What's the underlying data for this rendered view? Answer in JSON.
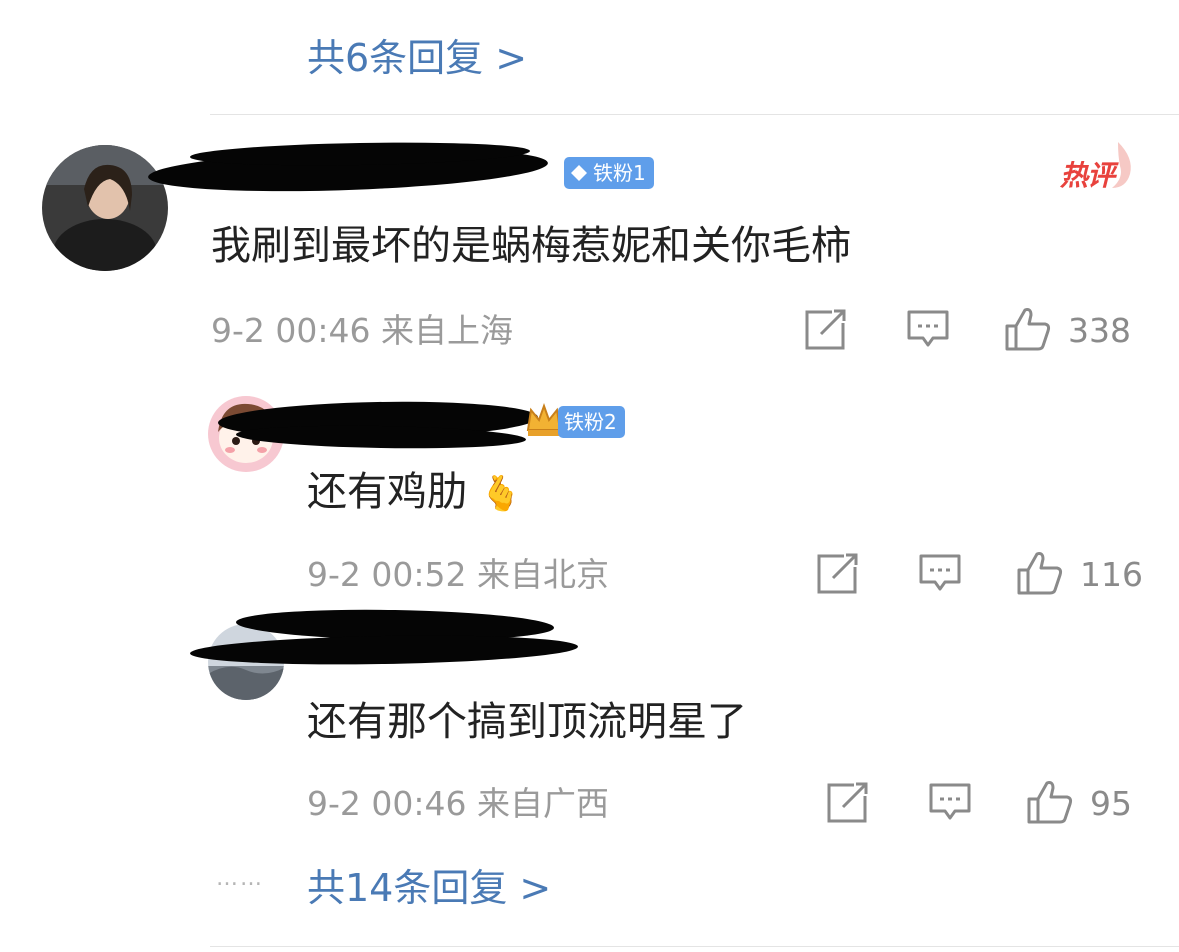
{
  "top_replies": {
    "label": "共6条回复 >"
  },
  "comments": [
    {
      "badge": "铁粉1",
      "hot_tag": "热评",
      "text": "我刷到最坏的是蜗梅惹妮和关你毛柿",
      "time": "9-2 00:46",
      "location": "来自上海",
      "likes": "338"
    },
    {
      "badge": "铁粉2",
      "text": "还有鸡肋",
      "emoji": "🫰",
      "time": "9-2 00:52",
      "location": "来自北京",
      "likes": "116"
    },
    {
      "text": "还有那个搞到顶流明星了",
      "time": "9-2 00:46",
      "location": "来自广西",
      "likes": "95"
    }
  ],
  "bottom_replies": {
    "dots": "……",
    "label": "共14条回复 >"
  },
  "colors": {
    "link": "#4a7ab5",
    "badge": "#5f9eea",
    "hot": "#e8423d"
  },
  "icons": [
    "share-icon",
    "comment-icon",
    "like-icon",
    "diamond-icon",
    "crown-icon"
  ]
}
